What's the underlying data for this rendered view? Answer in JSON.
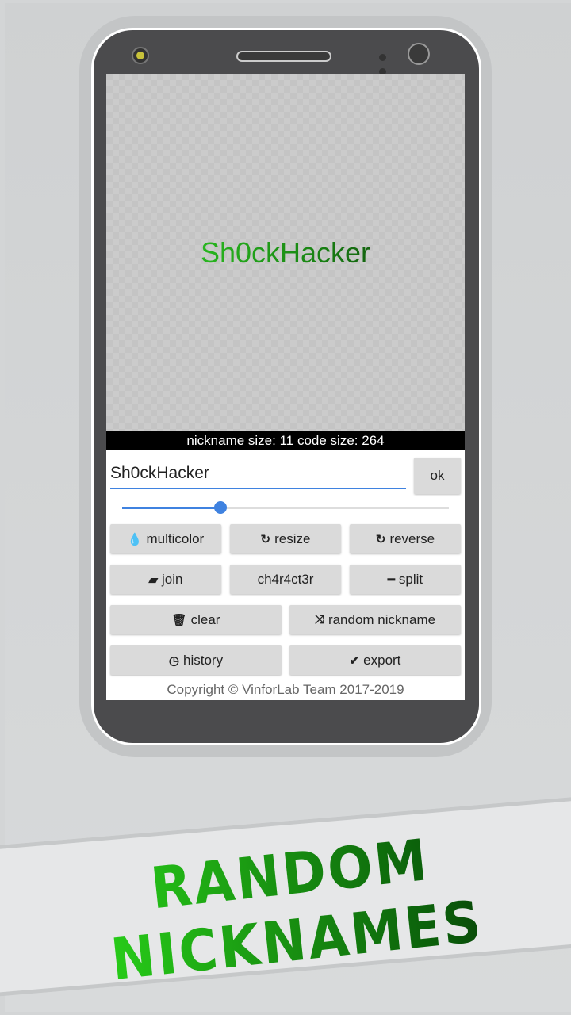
{
  "preview": {
    "nickname": "Sh0ckHacker",
    "info": "nickname size: 11 code size: 264"
  },
  "input": {
    "value": "Sh0ckHacker",
    "ok_label": "ok"
  },
  "slider": {
    "value_fraction": 0.3,
    "color": "#3f82e0"
  },
  "buttons": [
    {
      "label": "multicolor",
      "icon": "tint-icon",
      "glyph": "💧"
    },
    {
      "label": "resize",
      "icon": "redo-icon",
      "glyph": "↻"
    },
    {
      "label": "reverse",
      "icon": "redo-icon",
      "glyph": "↻"
    },
    {
      "label": "join",
      "icon": "eraser-icon",
      "glyph": "▰"
    },
    {
      "label": "ch4r4ct3r",
      "icon": "",
      "glyph": ""
    },
    {
      "label": "split",
      "icon": "minus-icon",
      "glyph": "━"
    },
    {
      "label": "clear",
      "icon": "trash-icon",
      "glyph": "🗑"
    },
    {
      "label": "random nickname",
      "icon": "shuffle-icon",
      "glyph": "⤨"
    },
    {
      "label": "history",
      "icon": "clock-icon",
      "glyph": "◷"
    },
    {
      "label": "export",
      "icon": "check-circle-icon",
      "glyph": "✔"
    }
  ],
  "copyright": "Copyright © VinforLab Team 2017-2019",
  "banner": {
    "title": "RANDOM NICKNAMES"
  }
}
